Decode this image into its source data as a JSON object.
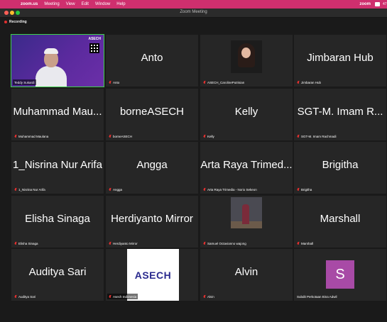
{
  "menubar": {
    "app": "zoom.us",
    "items": [
      "Meeting",
      "View",
      "Edit",
      "Window",
      "Help"
    ],
    "right_logo": "zoom",
    "clipped_text": "47"
  },
  "window": {
    "title": "Zoom Meeting"
  },
  "recording": {
    "label": "Recording"
  },
  "tiles": [
    {
      "label": "Teddy Sukardi",
      "big": "",
      "kind": "video-teddy",
      "active": true,
      "muted": false,
      "brand": "ASECH"
    },
    {
      "label": "Anto",
      "big": "Anto",
      "kind": "name",
      "active": false,
      "muted": true
    },
    {
      "label": "ASECH_CarolinePutrisian",
      "big": "",
      "kind": "photo-woman",
      "active": false,
      "muted": true
    },
    {
      "label": "Jimbaran Hub",
      "big": "Jimbaran Hub",
      "kind": "name",
      "active": false,
      "muted": true
    },
    {
      "label": "Muhammad Maulana",
      "big": "Muhammad Mau...",
      "kind": "name",
      "active": false,
      "muted": true
    },
    {
      "label": "borneASECH",
      "big": "borneASECH",
      "kind": "name",
      "active": false,
      "muted": true
    },
    {
      "label": "Kelly",
      "big": "Kelly",
      "kind": "name",
      "active": false,
      "muted": true
    },
    {
      "label": "SGT-M. Imam Rachmadi",
      "big": "SGT-M. Imam R...",
      "kind": "name",
      "active": false,
      "muted": true
    },
    {
      "label": "1_Nisrina Nur Arifa",
      "big": "1_Nisrina Nur Arifa",
      "kind": "name",
      "active": false,
      "muted": true
    },
    {
      "label": "Angga",
      "big": "Angga",
      "kind": "name",
      "active": false,
      "muted": true
    },
    {
      "label": "Arta Raya Trimedia - Norio Sekeon",
      "big": "Arta Raya Trimed...",
      "kind": "name",
      "active": false,
      "muted": true
    },
    {
      "label": "Brigitha",
      "big": "Brigitha",
      "kind": "name",
      "active": false,
      "muted": true
    },
    {
      "label": "Elisha Sinaga",
      "big": "Elisha Sinaga",
      "kind": "name",
      "active": false,
      "muted": true
    },
    {
      "label": "Herdiyanto Mirror",
      "big": "Herdiyanto Mirror",
      "kind": "name",
      "active": false,
      "muted": true
    },
    {
      "label": "Samuel Octavianno wajong",
      "big": "",
      "kind": "photo-outdoor",
      "active": false,
      "muted": true
    },
    {
      "label": "Marshall",
      "big": "Marshall",
      "kind": "name",
      "active": false,
      "muted": true
    },
    {
      "label": "Auditya Sari",
      "big": "Auditya Sari",
      "kind": "name",
      "active": false,
      "muted": true
    },
    {
      "label": "Asech Indonesia",
      "big": "",
      "kind": "logo-asech",
      "active": false,
      "muted": true,
      "logo_text": "ASECH"
    },
    {
      "label": "Alvin",
      "big": "Alvin",
      "kind": "name",
      "active": false,
      "muted": true
    },
    {
      "label": "Subdit Perkotaan Bina Adwil",
      "big": "",
      "kind": "avatar-s",
      "active": false,
      "muted": false,
      "avatar_letter": "S",
      "avatar_color": "#a84aa6"
    }
  ],
  "colors": {
    "active_border": "#3fd14c",
    "muted_icon": "#e0302f",
    "menubar": "#cf2f6e"
  }
}
